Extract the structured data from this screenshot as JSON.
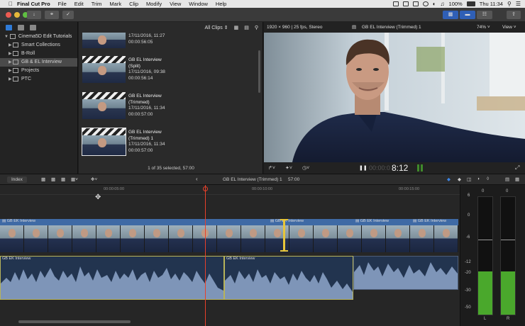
{
  "menubar": {
    "app_name": "Final Cut Pro",
    "items": [
      "File",
      "Edit",
      "Trim",
      "Mark",
      "Clip",
      "Modify",
      "View",
      "Window",
      "Help"
    ],
    "battery": "100%",
    "clock": "Thu 11:34"
  },
  "sidebar": {
    "library": "Cinema5D Edit Tutorials",
    "items": [
      {
        "label": "Smart Collections",
        "selected": false
      },
      {
        "label": "B-Roll",
        "selected": false
      },
      {
        "label": "GB & EL Interview",
        "selected": true
      },
      {
        "label": "Projects",
        "selected": false
      },
      {
        "label": "PTC",
        "selected": false
      }
    ]
  },
  "browser": {
    "filter_label": "All Clips",
    "clips": [
      {
        "title1": "",
        "title2": "",
        "date": "17/11/2016, 11:27",
        "duration": "00:00:56:05"
      },
      {
        "title1": "GB EL Interview",
        "title2": "(Split)",
        "date": "17/11/2016, 09:38",
        "duration": "00:00:56:14"
      },
      {
        "title1": "GB EL Interview",
        "title2": "(Trimmed)",
        "date": "17/11/2016, 11:34",
        "duration": "00:00:57:00"
      },
      {
        "title1": "GB EL Interview",
        "title2": "(Trimmed) 1",
        "date": "17/11/2016, 11:34",
        "duration": "00:00:57:00"
      }
    ],
    "selection_status": "1 of 35 selected, 57:00"
  },
  "viewer": {
    "format": "1920 × 960 | 25 fps, Stereo",
    "clip_name": "GB EL Interview (Trimmed) 1",
    "zoom": "74%",
    "view_label": "View",
    "timecode_prefix": "00:00:0",
    "timecode_main": "8:12"
  },
  "timeline_header": {
    "index_label": "Index",
    "project_name": "GB EL Interview (Trimmed) 1",
    "duration": "57:00",
    "ruler": [
      "00:00:05:00",
      "00:00:10:00",
      "00:00:15:00"
    ]
  },
  "timeline": {
    "clip_label": "GB EK Interview"
  },
  "meters": {
    "scale": [
      "6",
      "0",
      "-6",
      "-12",
      "-20",
      "-30",
      "-50"
    ],
    "top_labels": [
      "0",
      "0"
    ],
    "channels": [
      "L",
      "R"
    ],
    "level_left": 0.37,
    "level_right": 0.37
  },
  "colors": {
    "accent": "#2f7bd8",
    "selection": "#e6c53a",
    "playhead": "#e8402a",
    "clip_blue": "#3b5f93",
    "meter_green": "#4aa82c"
  }
}
